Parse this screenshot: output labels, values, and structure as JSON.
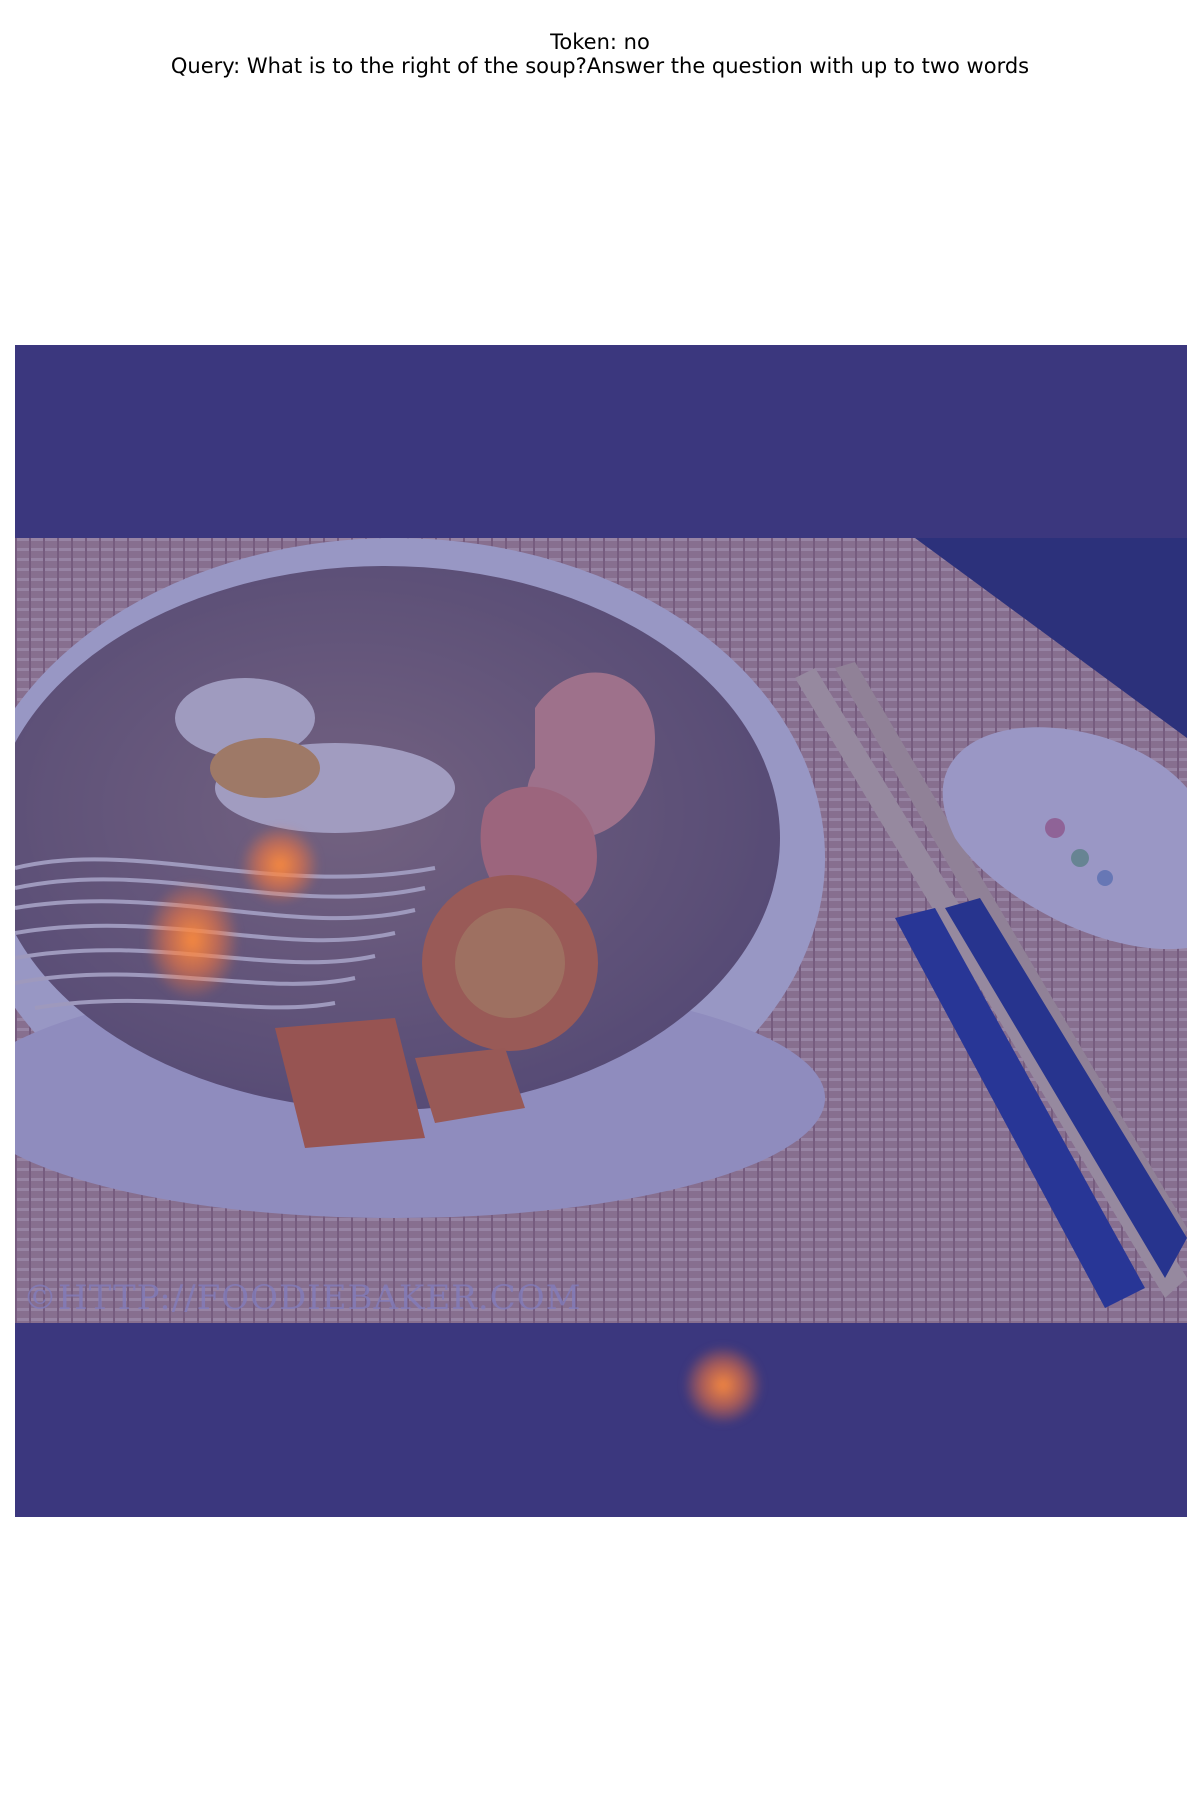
{
  "header": {
    "token_line": "Token: no",
    "query_line": "Query: What is to the right of the soup?Answer the question with up to two words"
  },
  "image": {
    "watermark": "©HTTP://FOODIEBAKER.COM",
    "scene": [
      "soup-bowl",
      "noodles",
      "shrimp",
      "carrot-slices",
      "chopsticks",
      "ceramic-spoon",
      "bamboo-placemat"
    ]
  },
  "overlay": {
    "tint_color": "#3f3b73",
    "heat_color": "#ff8a3c"
  }
}
